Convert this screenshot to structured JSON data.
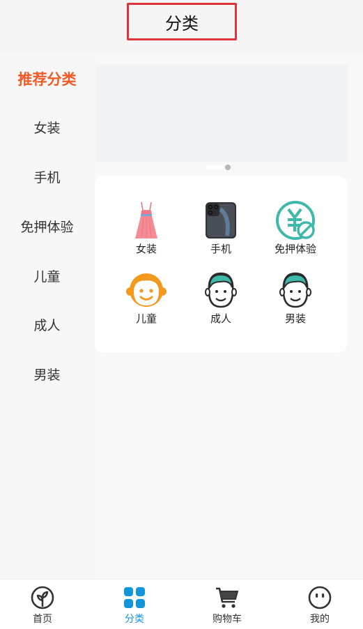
{
  "header": {
    "title": "分类"
  },
  "sidebar": {
    "items": [
      {
        "label": "推荐分类",
        "active": true
      },
      {
        "label": "女装"
      },
      {
        "label": "手机"
      },
      {
        "label": "免押体验"
      },
      {
        "label": "儿童"
      },
      {
        "label": "成人"
      },
      {
        "label": "男装"
      }
    ]
  },
  "main": {
    "categories": [
      {
        "label": "女装",
        "icon": "dress-icon"
      },
      {
        "label": "手机",
        "icon": "phone-icon"
      },
      {
        "label": "免押体验",
        "icon": "yuan-deposit-free-icon"
      },
      {
        "label": "儿童",
        "icon": "child-face-icon"
      },
      {
        "label": "成人",
        "icon": "adult-face-icon"
      },
      {
        "label": "男装",
        "icon": "man-face-icon"
      }
    ]
  },
  "tabbar": {
    "items": [
      {
        "label": "首页",
        "icon": "home-sprout-icon"
      },
      {
        "label": "分类",
        "icon": "grid-icon",
        "active": true
      },
      {
        "label": "购物车",
        "icon": "cart-icon"
      },
      {
        "label": "我的",
        "icon": "smile-face-icon"
      }
    ]
  },
  "colors": {
    "accent": "#f15a24",
    "tab_active": "#1296db",
    "title_border": "#e0343a"
  }
}
